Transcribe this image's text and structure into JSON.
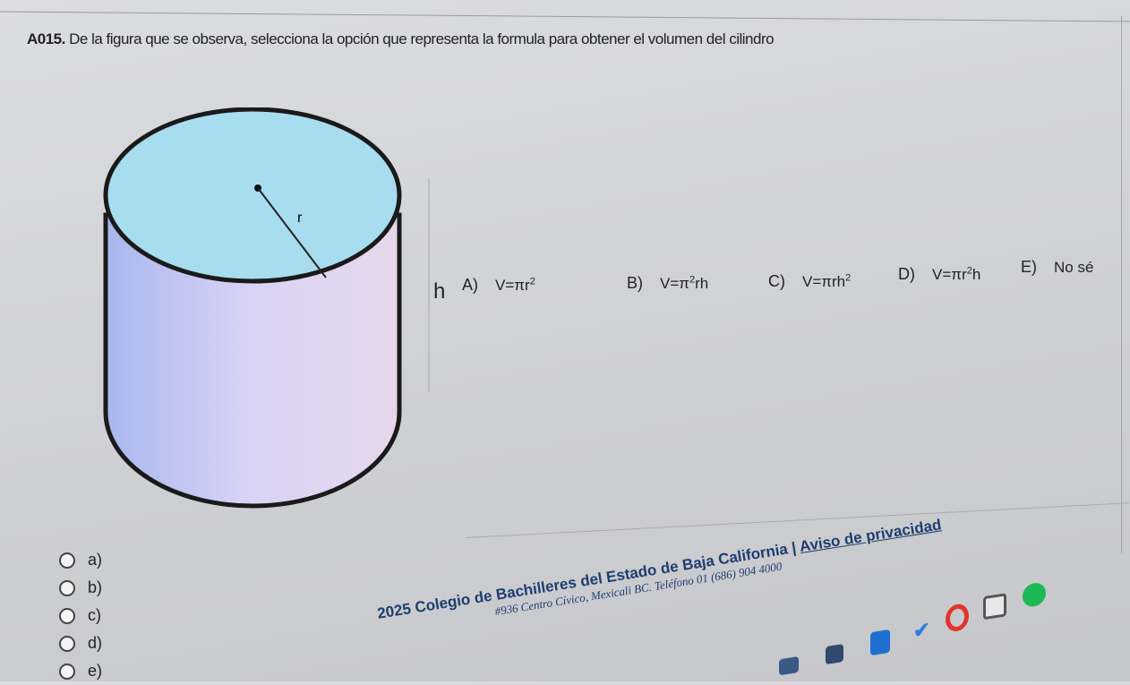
{
  "question": {
    "number": "A015.",
    "text": "De la figura que se observa, selecciona la opción que representa la formula para obtener el volumen del cilindro"
  },
  "figure": {
    "radius_label": "r",
    "height_label": "h"
  },
  "options": [
    {
      "letter": "A)",
      "formula_base": "V=πr",
      "sup": "2",
      "tail": ""
    },
    {
      "letter": "B)",
      "formula_base": "V=π",
      "sup": "2",
      "tail": "rh"
    },
    {
      "letter": "C)",
      "formula_base": "V=πrh",
      "sup": "2",
      "tail": ""
    },
    {
      "letter": "D)",
      "formula_base": "V=πr",
      "sup": "2",
      "tail": "h"
    },
    {
      "letter": "E)",
      "formula_base": "No sé",
      "sup": "",
      "tail": ""
    }
  ],
  "answers": [
    "a)",
    "b)",
    "c)",
    "d)",
    "e)"
  ],
  "footer": {
    "line1": "2025 Colegio de Bachilleres del Estado de Baja California |",
    "link": "Aviso de privacidad",
    "line2": "#936 Centro Cívico, Mexicali BC. Teléfono 01 (686) 904 4000"
  },
  "taskbar_icons": [
    "folder-icon",
    "star-icon",
    "word-icon",
    "check-icon",
    "opera-icon",
    "app-icon",
    "spotify-icon"
  ],
  "colors": {
    "cylinder_top": "#a8dcef",
    "cylinder_side": "#d7d2f2",
    "footer_text": "#1f3d70"
  }
}
